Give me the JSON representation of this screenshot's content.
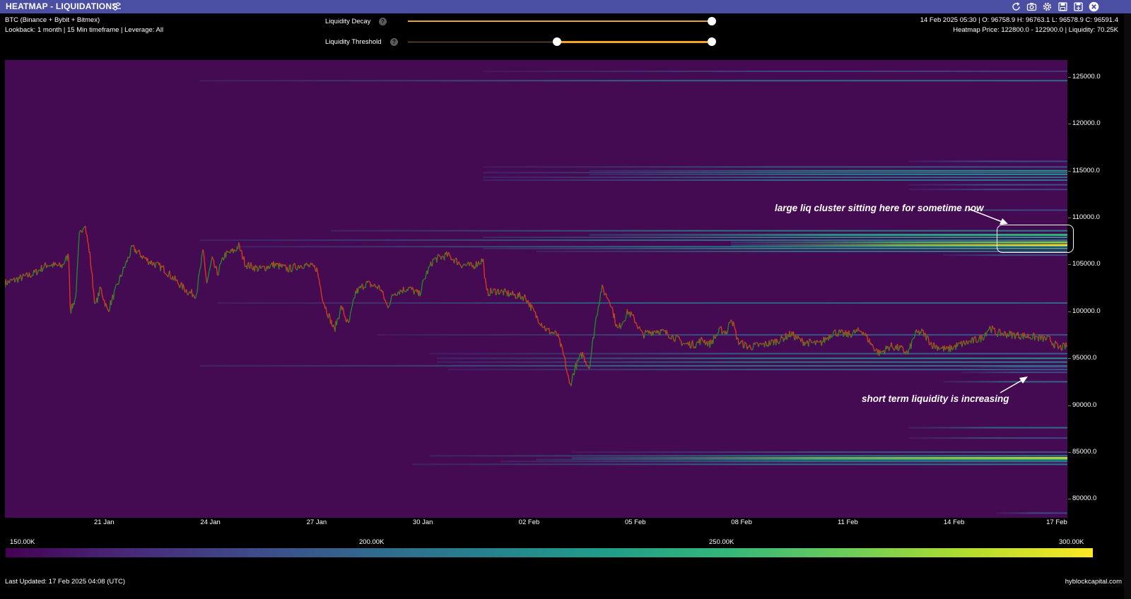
{
  "window": {
    "title": "HEATMAP - LIQUIDATIONS",
    "settings_icon": "sliders-icon",
    "toolbar_icons": [
      "refresh-icon",
      "camera-icon",
      "gear-icon",
      "save-icon",
      "save-as-icon",
      "close-icon"
    ]
  },
  "info": {
    "pair": "BTC (Binance + Bybit + Bitmex)",
    "lookback": "Lookback: 1 month | 15 Min timeframe | Leverage: All",
    "ohlc": "14 Feb 2025 05:30 | O: 96758.9 H: 96763.1 L: 96578.9 C: 96591.4",
    "heatmap_info": "Heatmap Price: 122800.0 - 122900.0 | Liquidity: 70.25K"
  },
  "controls": {
    "decay_label": "Liquidity Decay",
    "decay_value": 1.0,
    "threshold_label": "Liquidity Threshold",
    "threshold_low": 0.49,
    "threshold_high": 1.0,
    "help_glyph": "?"
  },
  "chart_data": {
    "type": "heatmap",
    "title": "",
    "x_tick_labels": [
      "21 Jan",
      "24 Jan",
      "27 Jan",
      "30 Jan",
      "02 Feb",
      "05 Feb",
      "08 Feb",
      "11 Feb",
      "14 Feb",
      "17 Feb"
    ],
    "y_tick_labels": [
      "125000.0",
      "120000.0",
      "115000.0",
      "110000.0",
      "105000.0",
      "100000.0",
      "95000.0",
      "90000.0",
      "85000.0",
      "80000.0"
    ],
    "ylim": [
      78000,
      126800
    ],
    "xlim_days": [
      0,
      30
    ],
    "x_tick_positions_days": [
      2.8,
      5.8,
      8.8,
      11.8,
      14.8,
      17.8,
      20.8,
      23.8,
      26.8,
      29.7
    ],
    "price_keypoints": [
      [
        0.0,
        103000
      ],
      [
        0.4,
        103500
      ],
      [
        0.8,
        104000
      ],
      [
        1.2,
        105000
      ],
      [
        1.6,
        104800
      ],
      [
        1.8,
        106000
      ],
      [
        1.85,
        100000
      ],
      [
        2.0,
        101500
      ],
      [
        2.1,
        108000
      ],
      [
        2.25,
        109500
      ],
      [
        2.4,
        106000
      ],
      [
        2.55,
        100500
      ],
      [
        2.7,
        102500
      ],
      [
        2.9,
        100000
      ],
      [
        3.1,
        102000
      ],
      [
        3.3,
        104000
      ],
      [
        3.6,
        106800
      ],
      [
        4.0,
        105500
      ],
      [
        4.5,
        104500
      ],
      [
        4.9,
        103000
      ],
      [
        5.2,
        102000
      ],
      [
        5.4,
        101800
      ],
      [
        5.6,
        106500
      ],
      [
        5.7,
        103000
      ],
      [
        5.85,
        105500
      ],
      [
        6.0,
        104000
      ],
      [
        6.2,
        106000
      ],
      [
        6.5,
        106500
      ],
      [
        6.6,
        107000
      ],
      [
        6.8,
        105000
      ],
      [
        7.2,
        104500
      ],
      [
        7.6,
        105000
      ],
      [
        8.0,
        104500
      ],
      [
        8.4,
        105000
      ],
      [
        8.8,
        104600
      ],
      [
        9.0,
        101000
      ],
      [
        9.3,
        98000
      ],
      [
        9.5,
        100500
      ],
      [
        9.7,
        98500
      ],
      [
        9.9,
        102000
      ],
      [
        10.2,
        103000
      ],
      [
        10.6,
        102500
      ],
      [
        10.8,
        100500
      ],
      [
        11.0,
        102000
      ],
      [
        11.4,
        102500
      ],
      [
        11.7,
        101800
      ],
      [
        11.9,
        104000
      ],
      [
        12.1,
        105500
      ],
      [
        12.5,
        106000
      ],
      [
        12.9,
        105000
      ],
      [
        13.2,
        104800
      ],
      [
        13.5,
        105500
      ],
      [
        13.6,
        102000
      ],
      [
        13.9,
        102200
      ],
      [
        14.3,
        101800
      ],
      [
        14.7,
        101500
      ],
      [
        15.0,
        99500
      ],
      [
        15.3,
        98000
      ],
      [
        15.6,
        97500
      ],
      [
        15.8,
        95000
      ],
      [
        15.95,
        92000
      ],
      [
        16.1,
        94000
      ],
      [
        16.3,
        95500
      ],
      [
        16.5,
        94000
      ],
      [
        16.7,
        99500
      ],
      [
        16.85,
        102500
      ],
      [
        17.1,
        101000
      ],
      [
        17.3,
        98000
      ],
      [
        17.6,
        100000
      ],
      [
        17.8,
        99000
      ],
      [
        18.0,
        97500
      ],
      [
        18.4,
        98000
      ],
      [
        18.8,
        97500
      ],
      [
        19.2,
        96500
      ],
      [
        19.5,
        96500
      ],
      [
        19.7,
        97000
      ],
      [
        19.9,
        96500
      ],
      [
        20.2,
        98000
      ],
      [
        20.4,
        97800
      ],
      [
        20.5,
        99500
      ],
      [
        20.7,
        96800
      ],
      [
        21.0,
        96200
      ],
      [
        21.5,
        96500
      ],
      [
        21.9,
        97000
      ],
      [
        22.2,
        97600
      ],
      [
        22.5,
        96800
      ],
      [
        23.0,
        96500
      ],
      [
        23.4,
        97800
      ],
      [
        23.8,
        97500
      ],
      [
        24.2,
        98000
      ],
      [
        24.5,
        96300
      ],
      [
        24.7,
        95500
      ],
      [
        25.0,
        96300
      ],
      [
        25.3,
        96000
      ],
      [
        25.5,
        95500
      ],
      [
        25.7,
        97600
      ],
      [
        25.9,
        97800
      ],
      [
        26.2,
        96400
      ],
      [
        26.6,
        95900
      ],
      [
        27.0,
        96500
      ],
      [
        27.3,
        96800
      ],
      [
        27.6,
        97200
      ],
      [
        27.8,
        98300
      ],
      [
        28.0,
        97700
      ],
      [
        28.5,
        97500
      ],
      [
        29.0,
        97300
      ],
      [
        29.5,
        97000
      ],
      [
        29.75,
        96100
      ],
      [
        30.0,
        96300
      ]
    ],
    "liquidity_bands": [
      {
        "price": 125600,
        "start_day": 13.5,
        "level": 0.05
      },
      {
        "price": 124600,
        "start_day": 5.5,
        "level": 0.25
      },
      {
        "price": 116000,
        "start_day": 25.5,
        "level": 0.12
      },
      {
        "price": 115400,
        "start_day": 13.5,
        "level": 0.15
      },
      {
        "price": 115000,
        "start_day": 16.5,
        "level": 0.45
      },
      {
        "price": 114800,
        "start_day": 13.5,
        "level": 0.3
      },
      {
        "price": 114600,
        "start_day": 16.5,
        "level": 0.38
      },
      {
        "price": 114300,
        "start_day": 13.5,
        "level": 0.25
      },
      {
        "price": 114000,
        "start_day": 13.5,
        "level": 0.3
      },
      {
        "price": 113500,
        "start_day": 25.5,
        "level": 0.15
      },
      {
        "price": 113000,
        "start_day": 25.5,
        "level": 0.1
      },
      {
        "price": 110800,
        "start_day": 26.0,
        "level": 0.1
      },
      {
        "price": 108600,
        "start_day": 9.2,
        "level": 0.35
      },
      {
        "price": 108200,
        "start_day": 16.5,
        "level": 0.55
      },
      {
        "price": 107900,
        "start_day": 13.5,
        "level": 0.45
      },
      {
        "price": 107600,
        "start_day": 5.5,
        "level": 0.3
      },
      {
        "price": 107400,
        "start_day": 20.5,
        "level": 0.7
      },
      {
        "price": 107100,
        "start_day": 20.5,
        "level": 0.9
      },
      {
        "price": 106900,
        "start_day": 6.5,
        "level": 0.3
      },
      {
        "price": 106700,
        "start_day": 13.5,
        "level": 0.5
      },
      {
        "price": 106400,
        "start_day": 15.0,
        "level": 0.35
      },
      {
        "price": 106000,
        "start_day": 26.5,
        "level": 0.15
      },
      {
        "price": 100900,
        "start_day": 6.0,
        "level": 0.22
      },
      {
        "price": 97500,
        "start_day": 10.5,
        "level": 0.15
      },
      {
        "price": 95500,
        "start_day": 12.0,
        "level": 0.2
      },
      {
        "price": 95000,
        "start_day": 12.2,
        "level": 0.4
      },
      {
        "price": 94600,
        "start_day": 12.2,
        "level": 0.35
      },
      {
        "price": 94200,
        "start_day": 5.5,
        "level": 0.3
      },
      {
        "price": 94100,
        "start_day": 27.0,
        "level": 0.15
      },
      {
        "price": 93800,
        "start_day": 12.5,
        "level": 0.2
      },
      {
        "price": 93500,
        "start_day": 27.0,
        "level": 0.12
      },
      {
        "price": 92500,
        "start_day": 26.5,
        "level": 0.22
      },
      {
        "price": 87600,
        "start_day": 25.5,
        "level": 0.25
      },
      {
        "price": 86500,
        "start_day": 25.5,
        "level": 0.12
      },
      {
        "price": 85000,
        "start_day": 16.0,
        "level": 0.15
      },
      {
        "price": 84600,
        "start_day": 12.0,
        "level": 0.35
      },
      {
        "price": 84400,
        "start_day": 16.0,
        "level": 0.8
      },
      {
        "price": 84200,
        "start_day": 15.0,
        "level": 0.5
      },
      {
        "price": 84000,
        "start_day": 14.0,
        "level": 0.35
      },
      {
        "price": 83700,
        "start_day": 11.5,
        "level": 0.3
      },
      {
        "price": 78500,
        "start_day": 28.0,
        "level": 0.1
      }
    ]
  },
  "annotations": {
    "cluster_text": "large liq cluster sitting here for sometime now",
    "short_term_text": "short term liquidity is increasing"
  },
  "colorbar": {
    "labels": [
      "150.00K",
      "200.00K",
      "250.00K",
      "300.00K"
    ],
    "colors": [
      "#440154",
      "#482878",
      "#3e4989",
      "#31688e",
      "#26828e",
      "#1f9e89",
      "#35b779",
      "#6ece58",
      "#b5de2b",
      "#fde725"
    ]
  },
  "colors": {
    "titlebar": "#4a4fa3",
    "plot_bg": "#440a52",
    "slider": "#f5a623",
    "candle_up": "#1b8a2a",
    "candle_down": "#e0331c"
  },
  "footer": {
    "last_updated": "Last Updated: 17 Feb 2025 04:08 (UTC)",
    "brand": "hyblockcapital.com"
  }
}
